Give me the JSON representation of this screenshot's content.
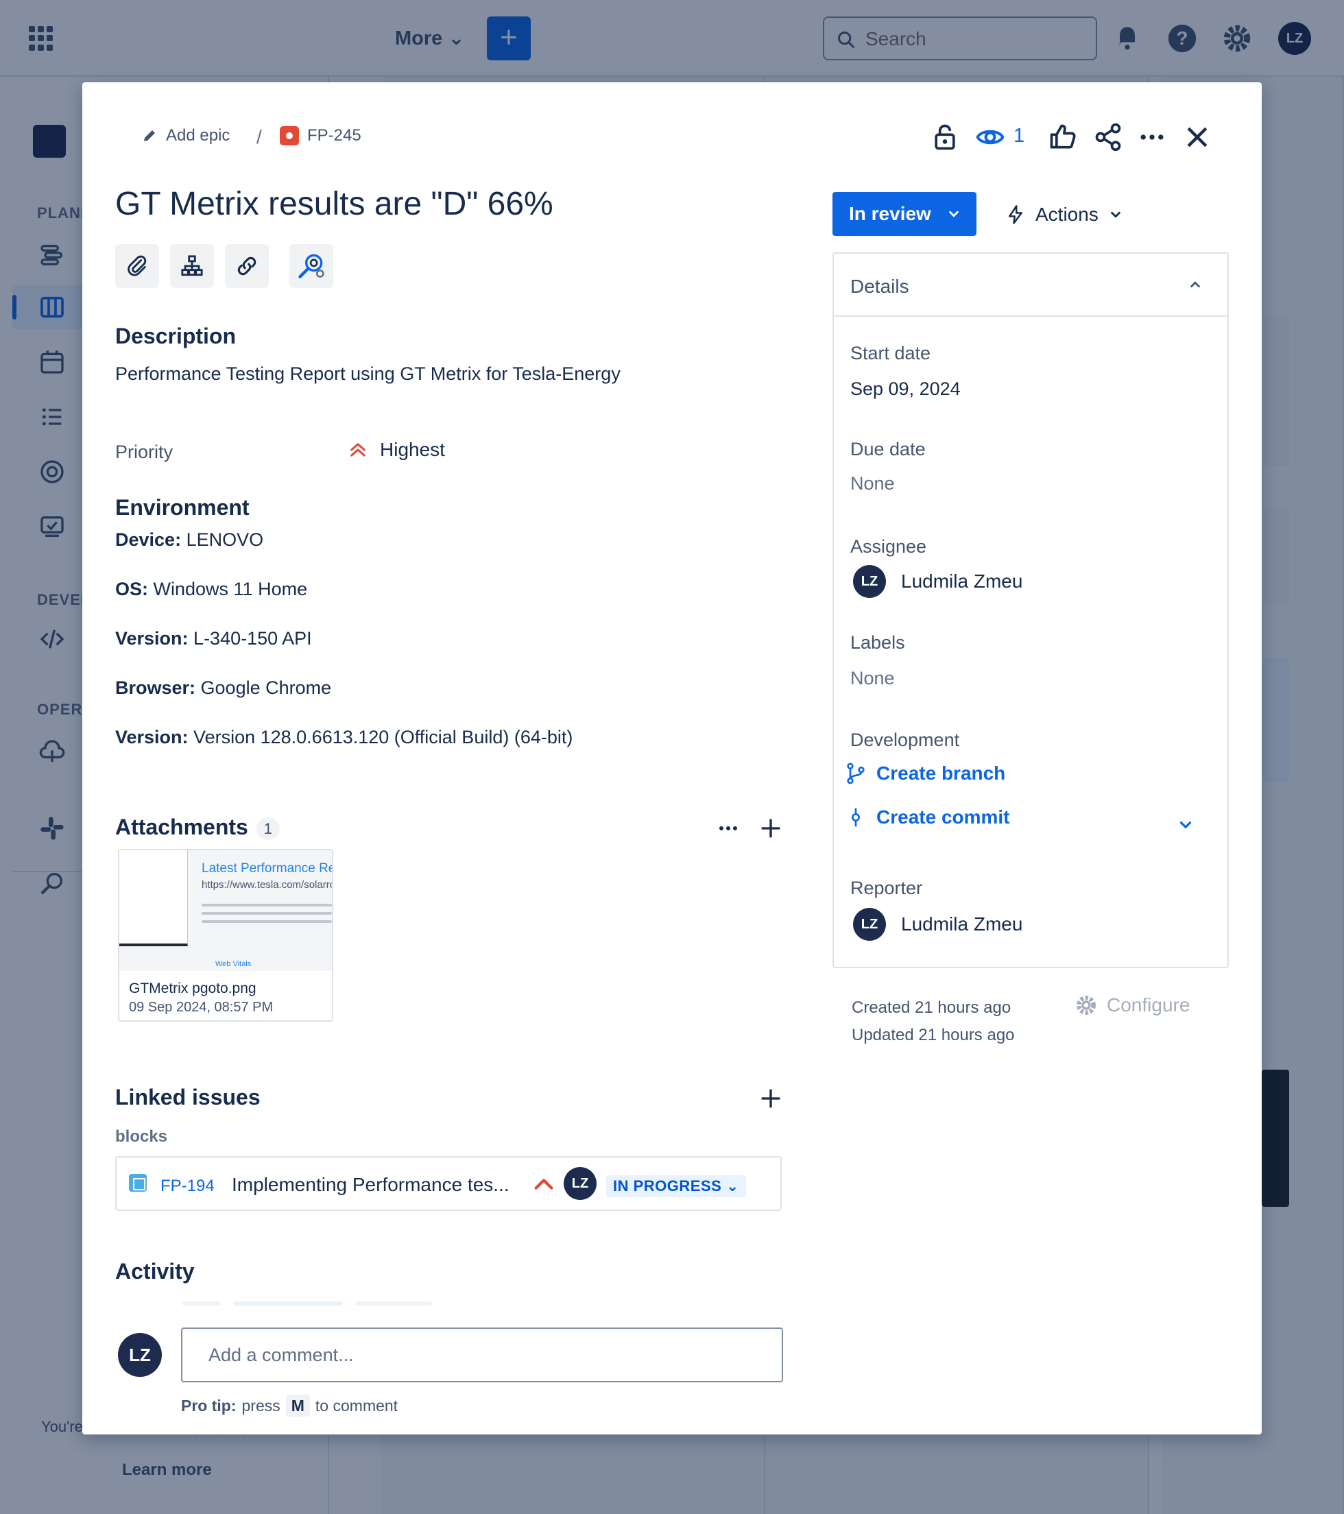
{
  "topbar": {
    "more_label": "More",
    "create_label": "+",
    "search_placeholder": "Search",
    "user_initials": "LZ"
  },
  "sidebar": {
    "sections": {
      "planning": "PLANNING",
      "development": "DEVELOPMENT",
      "operations": "OPERATIONS"
    },
    "footer_note": "You're in a team-managed project",
    "learn_more": "Learn more"
  },
  "issue": {
    "breadcrumb": {
      "add_epic": "Add epic",
      "separator": "/",
      "key": "FP-245"
    },
    "watchers_count": "1",
    "title": "GT Metrix results are \"D\" 66%",
    "description": {
      "heading": "Description",
      "text": "Performance Testing Report using GT Metrix for Tesla-Energy"
    },
    "priority": {
      "label": "Priority",
      "value": "Highest"
    },
    "environment": {
      "heading": "Environment",
      "rows": [
        {
          "key": "Device:",
          "value": " LENOVO"
        },
        {
          "key": "OS:",
          "value": " Windows 11 Home"
        },
        {
          "key": "Version:",
          "value": " L-340-150 API"
        },
        {
          "key": "Browser:",
          "value": " Google Chrome"
        },
        {
          "key": "Version:",
          "value": " Version 128.0.6613.120 (Official Build) (64-bit)"
        }
      ]
    },
    "attachments": {
      "heading": "Attachments",
      "count": "1",
      "items": [
        {
          "name": "GTMetrix pgoto.png",
          "date": "09 Sep 2024, 08:57 PM",
          "thumb_title": "Latest Performance Re",
          "thumb_url": "https://www.tesla.com/solarro",
          "thumb_footer": "Web Vitals"
        }
      ]
    },
    "linked_issues": {
      "heading": "Linked issues",
      "relation": "blocks",
      "items": [
        {
          "key": "FP-194",
          "summary": "Implementing Performance tes...",
          "assignee_initials": "LZ",
          "status": "IN PROGRESS"
        }
      ]
    },
    "activity": {
      "heading": "Activity",
      "commenter_initials": "LZ",
      "comment_placeholder": "Add a comment...",
      "protip_bold": "Pro tip:",
      "protip_press": "press",
      "protip_key": "M",
      "protip_rest": "to comment"
    },
    "status_button": "In review",
    "actions_button": "Actions",
    "details": {
      "heading": "Details",
      "start_date_label": "Start date",
      "start_date_value": "Sep 09, 2024",
      "due_date_label": "Due date",
      "due_date_value": "None",
      "assignee_label": "Assignee",
      "assignee_name": "Ludmila Zmeu",
      "assignee_initials": "LZ",
      "labels_label": "Labels",
      "labels_value": "None",
      "development_label": "Development",
      "create_branch": "Create branch",
      "create_commit": "Create commit",
      "reporter_label": "Reporter",
      "reporter_name": "Ludmila Zmeu",
      "reporter_initials": "LZ"
    },
    "created": "Created 21 hours ago",
    "updated": "Updated 21 hours ago",
    "configure": "Configure"
  },
  "colors": {
    "brand_blue": "#0c66e4",
    "priority_highest": "#e2483d",
    "text_primary": "#172b4d",
    "text_subtle": "#44546f"
  }
}
